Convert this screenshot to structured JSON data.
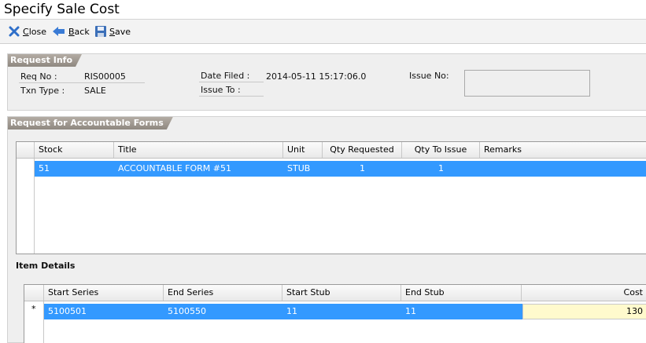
{
  "window": {
    "title": "Specify Sale Cost"
  },
  "toolbar": {
    "close": "Close",
    "back": "Back",
    "save": "Save"
  },
  "request_info": {
    "section": "Request Info",
    "req_no_label": "Req No :",
    "req_no": "RIS00005",
    "txn_type_label": "Txn Type :",
    "txn_type": "SALE",
    "date_filed_label": "Date Filed :",
    "date_filed": "2014-05-11 15:17:06.0",
    "issue_to_label": "Issue To :",
    "issue_to": "",
    "issue_no_label": "Issue  No:",
    "issue_no": ""
  },
  "forms": {
    "section": "Request for Accountable Forms",
    "columns": [
      "Stock",
      "Title",
      "Unit",
      "Qty Requested",
      "Qty To Issue",
      "Remarks"
    ],
    "rows": [
      {
        "stock": "51",
        "title": "ACCOUNTABLE FORM #51",
        "unit": "STUB",
        "qty_requested": "1",
        "qty_to_issue": "1",
        "remarks": ""
      }
    ]
  },
  "item_details": {
    "section": "Item Details",
    "columns": [
      "Start Series",
      "End Series",
      "Start Stub",
      "End Stub",
      "Cost"
    ],
    "rows": [
      {
        "marker": "*",
        "start_series": "5100501",
        "end_series": "5100550",
        "start_stub": "11",
        "end_stub": "11",
        "cost": "130"
      }
    ]
  },
  "colors": {
    "selection": "#3399ff",
    "edit_cell": "#fffacd",
    "tag": "#9a938b"
  }
}
